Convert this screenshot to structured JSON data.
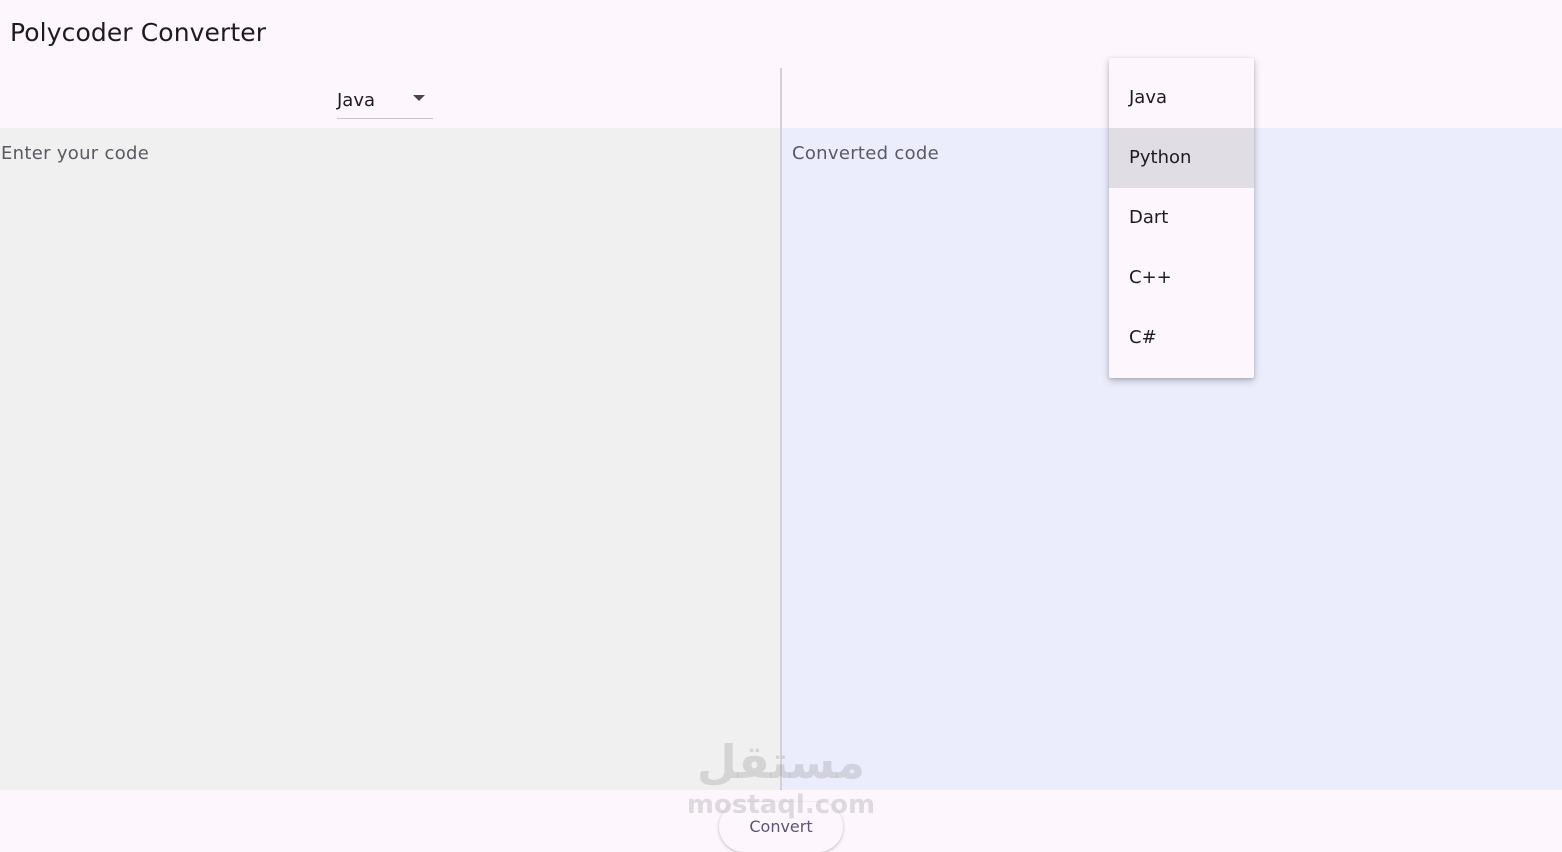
{
  "app": {
    "title": "Polycoder Converter"
  },
  "source": {
    "selected_language": "Java",
    "placeholder": "Enter your code"
  },
  "target": {
    "placeholder": "Converted code",
    "menu": {
      "items": [
        "Java",
        "Python",
        "Dart",
        "C++",
        "C#"
      ],
      "highlighted": "Python"
    }
  },
  "actions": {
    "convert_label": "Convert"
  },
  "watermark": {
    "logo_text": "مستقل",
    "site": "mostaql.com"
  },
  "colors": {
    "source_bg": "#f0f0f0",
    "target_bg": "#ebedfd",
    "menu_highlight": "#e1dde4"
  }
}
